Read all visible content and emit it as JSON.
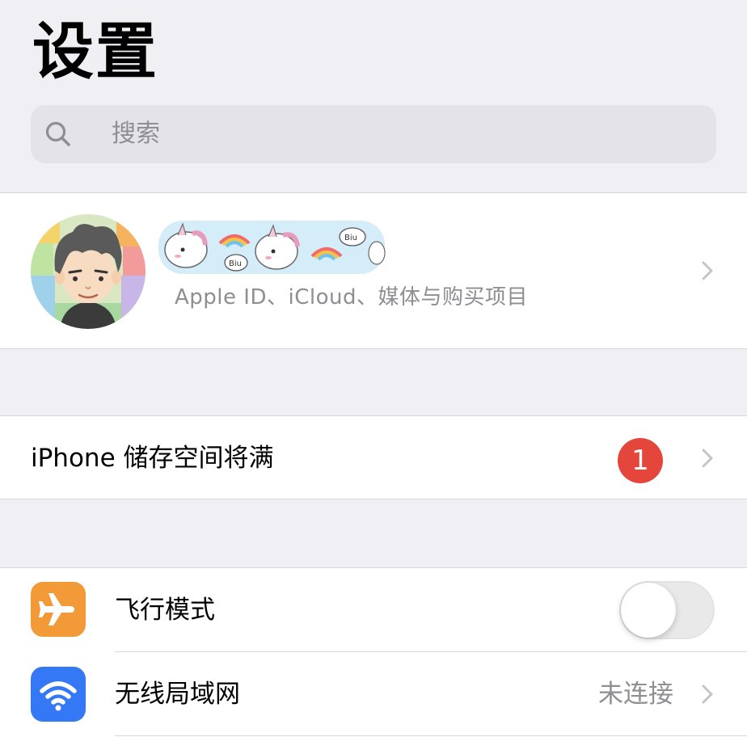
{
  "header": {
    "title": "设置"
  },
  "search": {
    "placeholder": "搜索",
    "icon": "search-icon"
  },
  "profile": {
    "subtitle": "Apple ID、iCloud、媒体与购买项目",
    "avatar": "cartoon-avatar"
  },
  "storage_alert": {
    "label": "iPhone 储存空间将满",
    "badge": "1",
    "badge_color": "#e5463b"
  },
  "settings": {
    "items": [
      {
        "label": "飞行模式",
        "icon": "airplane-icon",
        "icon_color": "#f19a37",
        "toggle_on": false
      },
      {
        "label": "无线局域网",
        "icon": "wifi-icon",
        "icon_color": "#3478f6",
        "value": "未连接"
      }
    ]
  }
}
